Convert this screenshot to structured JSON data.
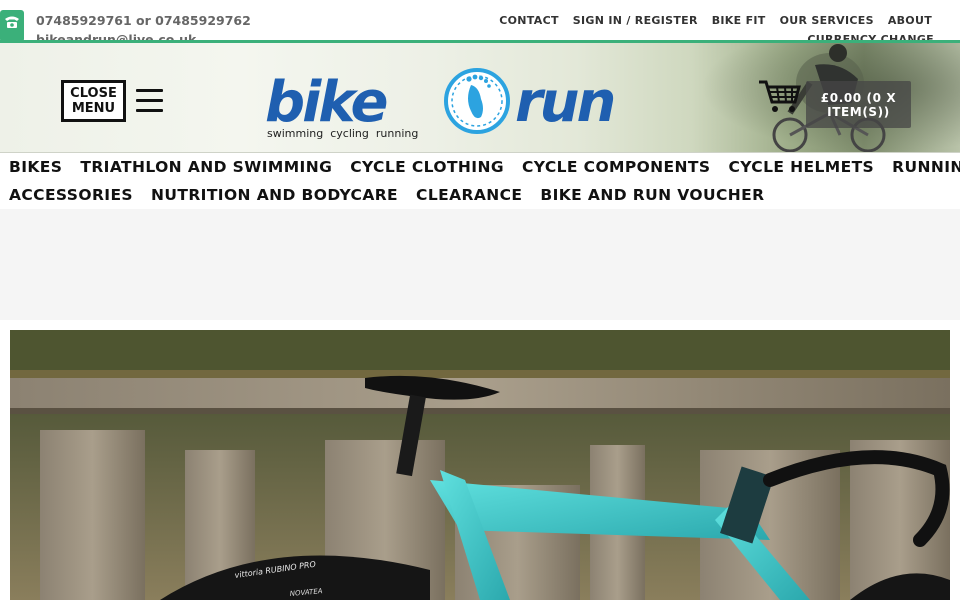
{
  "topbar": {
    "phone": "07485929761 or 07485929762",
    "email": "bikeandrun@live.co.uk",
    "links": [
      "CONTACT",
      "SIGN IN / REGISTER",
      "BIKE FIT",
      "OUR SERVICES",
      "ABOUT"
    ],
    "currency_change": "CURRENCY CHANGE"
  },
  "header": {
    "close_menu_label": "CLOSE MENU",
    "logo": {
      "word_left": "bike",
      "word_right": "run",
      "tagline": "swimming  cycling  running"
    },
    "cart_label": "£0.00 (0 X ITEM(S))"
  },
  "nav": {
    "row1": [
      "BIKES",
      "TRIATHLON AND SWIMMING",
      "CYCLE CLOTHING",
      "CYCLE COMPONENTS",
      "CYCLE HELMETS",
      "RUNNING"
    ],
    "row2": [
      "ACCESSORIES",
      "NUTRITION AND BODYCARE",
      "CLEARANCE",
      "BIKE AND RUN VOUCHER"
    ]
  },
  "banner": {
    "tyre_text_1": "vittoria RUBINO PRO",
    "tyre_text_2": "NOVATEA"
  },
  "colors": {
    "accent_green": "#3bb07a",
    "logo_blue": "#1f5fb0",
    "logo_light_blue": "#2ca3e0",
    "frame_teal": "#3fc7c9"
  },
  "icons": [
    "phone-icon",
    "hamburger-icon",
    "cart-icon"
  ]
}
